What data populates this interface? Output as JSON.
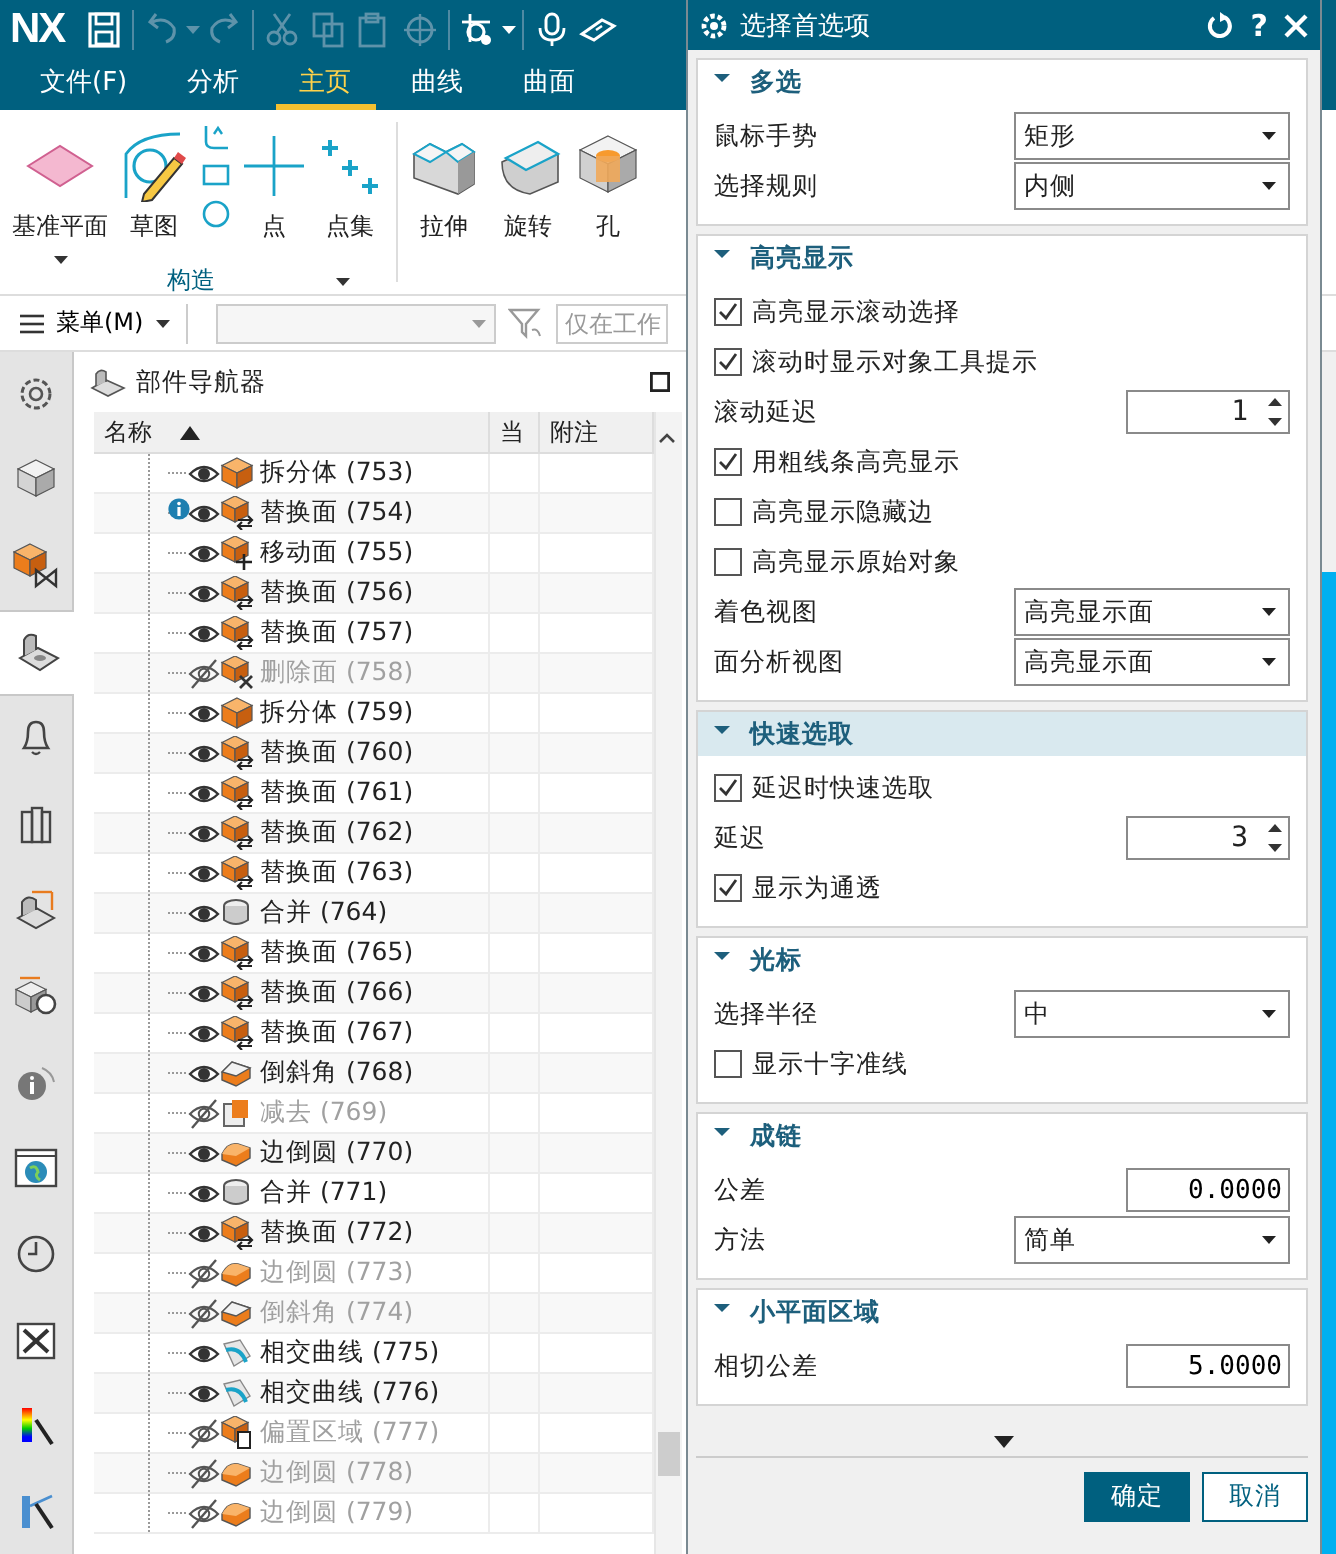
{
  "window": {
    "logo": "NX",
    "quick_access": [
      {
        "disabled": false
      },
      {
        "disabled": true
      },
      {
        "disabled": true
      },
      {
        "disabled": true
      },
      {
        "disabled": true
      },
      {
        "disabled": true
      },
      {
        "disabled": true
      },
      {
        "disabled": false
      },
      {
        "disabled": false
      },
      {
        "disabled": false
      }
    ]
  },
  "tabs": [
    {
      "label": "文件(F)",
      "selected": false
    },
    {
      "label": "分析",
      "selected": false
    },
    {
      "label": "主页",
      "selected": true
    },
    {
      "label": "曲线",
      "selected": false
    },
    {
      "label": "曲面",
      "selected": false
    }
  ],
  "ribbon": {
    "groups": [
      {
        "label": "构造",
        "items": [
          {
            "kind": "large",
            "label": "基准平面",
            "caret": true
          },
          {
            "kind": "large",
            "label": "草图",
            "caret": false
          },
          {
            "kind": "stack"
          },
          {
            "kind": "large",
            "label": "点",
            "caret": false
          },
          {
            "kind": "large",
            "label": "点集",
            "caret": false
          }
        ]
      },
      {
        "items": [
          {
            "kind": "large",
            "label": "拉伸",
            "caret": false
          },
          {
            "kind": "large",
            "label": "旋转",
            "caret": false
          },
          {
            "kind": "large",
            "label": "孔",
            "caret": false
          }
        ]
      }
    ]
  },
  "toolbar": {
    "menu": "菜单(M)",
    "filter_value": "仅在工作"
  },
  "side_tabs": [
    {
      "selected": false
    },
    {
      "selected": false
    },
    {
      "selected": false
    },
    {
      "selected": true
    },
    {
      "selected": false
    },
    {
      "selected": false
    },
    {
      "selected": false
    },
    {
      "selected": false
    },
    {
      "selected": false
    },
    {
      "selected": false
    },
    {
      "selected": false
    },
    {
      "selected": false
    },
    {
      "selected": false
    },
    {
      "selected": false
    }
  ],
  "part_navigator": {
    "title": "部件导航器",
    "columns": [
      "名称",
      "当",
      "附注"
    ],
    "sort_ascending": true,
    "rows": [
      {
        "name": "拆分体 (753)",
        "kind": "split",
        "suppressed": false,
        "info": false
      },
      {
        "name": "替换面 (754)",
        "kind": "replace",
        "suppressed": false,
        "info": true
      },
      {
        "name": "移动面 (755)",
        "kind": "move",
        "suppressed": false,
        "info": false
      },
      {
        "name": "替换面 (756)",
        "kind": "replace",
        "suppressed": false,
        "info": false
      },
      {
        "name": "替换面 (757)",
        "kind": "replace",
        "suppressed": false,
        "info": false
      },
      {
        "name": "删除面 (758)",
        "kind": "delete",
        "suppressed": true,
        "info": false
      },
      {
        "name": "拆分体 (759)",
        "kind": "split",
        "suppressed": false,
        "info": false
      },
      {
        "name": "替换面 (760)",
        "kind": "replace",
        "suppressed": false,
        "info": false
      },
      {
        "name": "替换面 (761)",
        "kind": "replace",
        "suppressed": false,
        "info": false
      },
      {
        "name": "替换面 (762)",
        "kind": "replace",
        "suppressed": false,
        "info": false
      },
      {
        "name": "替换面 (763)",
        "kind": "replace",
        "suppressed": false,
        "info": false
      },
      {
        "name": "合并 (764)",
        "kind": "unite",
        "suppressed": false,
        "info": false
      },
      {
        "name": "替换面 (765)",
        "kind": "replace",
        "suppressed": false,
        "info": false
      },
      {
        "name": "替换面 (766)",
        "kind": "replace",
        "suppressed": false,
        "info": false
      },
      {
        "name": "替换面 (767)",
        "kind": "replace",
        "suppressed": false,
        "info": false
      },
      {
        "name": "倒斜角 (768)",
        "kind": "chamfer",
        "suppressed": false,
        "info": false
      },
      {
        "name": "减去 (769)",
        "kind": "subtract",
        "suppressed": true,
        "info": false
      },
      {
        "name": "边倒圆 (770)",
        "kind": "blend",
        "suppressed": false,
        "info": false
      },
      {
        "name": "合并 (771)",
        "kind": "unite",
        "suppressed": false,
        "info": false
      },
      {
        "name": "替换面 (772)",
        "kind": "replace",
        "suppressed": false,
        "info": false
      },
      {
        "name": "边倒圆 (773)",
        "kind": "blend",
        "suppressed": true,
        "info": false
      },
      {
        "name": "倒斜角 (774)",
        "kind": "chamfer",
        "suppressed": true,
        "info": false
      },
      {
        "name": "相交曲线 (775)",
        "kind": "curve",
        "suppressed": false,
        "info": false
      },
      {
        "name": "相交曲线 (776)",
        "kind": "curve",
        "suppressed": false,
        "info": false
      },
      {
        "name": "偏置区域 (777)",
        "kind": "offset",
        "suppressed": true,
        "info": false
      },
      {
        "name": "边倒圆 (778)",
        "kind": "blend",
        "suppressed": true,
        "info": false
      },
      {
        "name": "边倒圆 (779)",
        "kind": "blend",
        "suppressed": true,
        "info": false
      }
    ]
  },
  "dialog": {
    "title": "选择首选项",
    "help": "?",
    "sections": [
      {
        "title": "多选",
        "expanded": true,
        "selected": false,
        "rows": [
          {
            "kind": "dropdown",
            "label": "鼠标手势",
            "value": "矩形"
          },
          {
            "kind": "dropdown",
            "label": "选择规则",
            "value": "内侧"
          }
        ]
      },
      {
        "title": "高亮显示",
        "expanded": true,
        "selected": false,
        "rows": [
          {
            "kind": "checkbox",
            "label": "高亮显示滚动选择",
            "checked": true
          },
          {
            "kind": "checkbox",
            "label": "滚动时显示对象工具提示",
            "checked": true
          },
          {
            "kind": "spinner",
            "label": "滚动延迟",
            "value": "1"
          },
          {
            "kind": "checkbox",
            "label": "用粗线条高亮显示",
            "checked": true
          },
          {
            "kind": "checkbox",
            "label": "高亮显示隐藏边",
            "checked": false
          },
          {
            "kind": "checkbox",
            "label": "高亮显示原始对象",
            "checked": false
          },
          {
            "kind": "dropdown",
            "label": "着色视图",
            "value": "高亮显示面"
          },
          {
            "kind": "dropdown",
            "label": "面分析视图",
            "value": "高亮显示面"
          }
        ]
      },
      {
        "title": "快速选取",
        "expanded": true,
        "selected": true,
        "rows": [
          {
            "kind": "checkbox",
            "label": "延迟时快速选取",
            "checked": true
          },
          {
            "kind": "spinner",
            "label": "延迟",
            "value": "3"
          },
          {
            "kind": "checkbox",
            "label": "显示为通透",
            "checked": true
          }
        ]
      },
      {
        "title": "光标",
        "expanded": true,
        "selected": false,
        "rows": [
          {
            "kind": "dropdown",
            "label": "选择半径",
            "value": "中"
          },
          {
            "kind": "checkbox",
            "label": "显示十字准线",
            "checked": false
          }
        ]
      },
      {
        "title": "成链",
        "expanded": true,
        "selected": false,
        "rows": [
          {
            "kind": "number",
            "label": "公差",
            "value": "0.0000"
          },
          {
            "kind": "dropdown",
            "label": "方法",
            "value": "简单"
          }
        ]
      },
      {
        "title": "小平面区域",
        "expanded": true,
        "selected": false,
        "rows": [
          {
            "kind": "number",
            "label": "相切公差",
            "value": "5.0000"
          }
        ]
      }
    ],
    "buttons": [
      {
        "label": "确定",
        "primary": true
      },
      {
        "label": "取消",
        "primary": false
      }
    ]
  }
}
